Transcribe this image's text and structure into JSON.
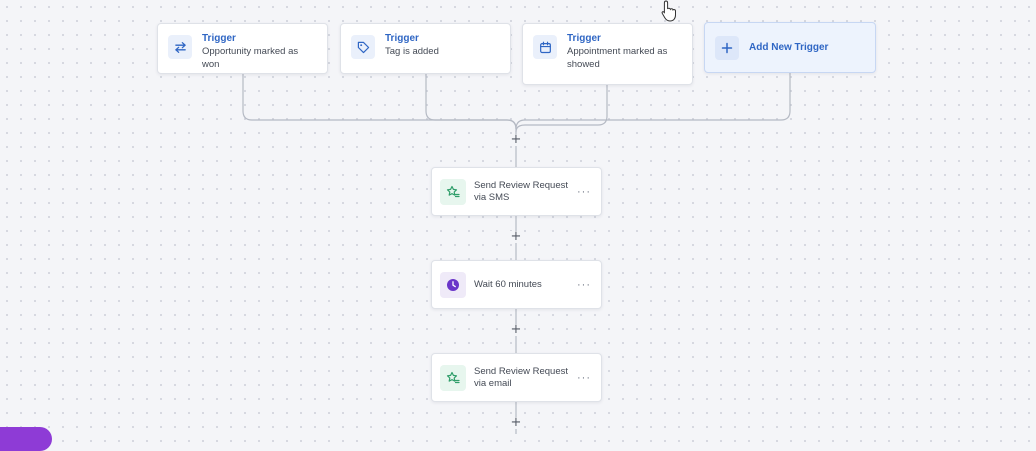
{
  "triggers": [
    {
      "label": "Trigger",
      "description": "Opportunity marked as won",
      "icon": "swap-arrows-icon"
    },
    {
      "label": "Trigger",
      "description": "Tag is added",
      "icon": "tag-icon"
    },
    {
      "label": "Trigger",
      "description": "Appointment marked as showed",
      "icon": "calendar-icon"
    }
  ],
  "add_trigger": {
    "label": "Add New Trigger",
    "icon": "plus-icon"
  },
  "actions": [
    {
      "label": "Send Review Request via SMS",
      "icon": "star-list-icon",
      "more": "···"
    },
    {
      "label": "Wait 60 minutes",
      "icon": "clock-icon",
      "more": "···"
    },
    {
      "label": "Send Review Request via email",
      "icon": "star-list-icon",
      "more": "···"
    }
  ],
  "add_step_symbol": "+",
  "colors": {
    "accent": "#2f66c4",
    "trigger_icon_bg": "#eaf0fb",
    "action_icon_green": "#2f9e6a",
    "wait_icon_violet": "#6a35c9",
    "connector": "#b5bac4"
  }
}
